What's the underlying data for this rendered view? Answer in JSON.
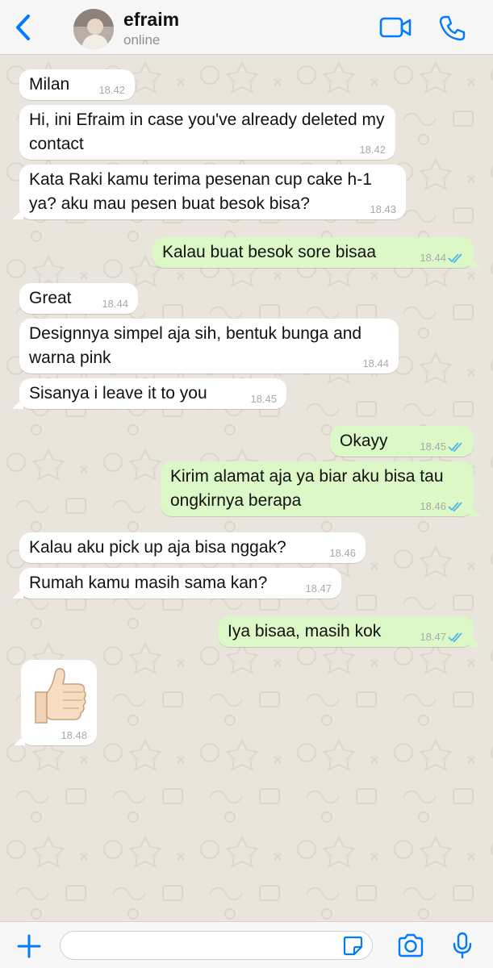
{
  "header": {
    "contact_name": "efraim",
    "status": "online",
    "icons": [
      "back-chevron-icon",
      "video-call-icon",
      "phone-call-icon"
    ]
  },
  "messages": [
    {
      "direction": "in",
      "text": "Milan",
      "time": "18.42"
    },
    {
      "direction": "in",
      "text": "Hi, ini Efraim in case you've already deleted my contact",
      "time": "18.42"
    },
    {
      "direction": "in",
      "text": "Kata Raki kamu terima pesenan cup cake h-1 ya? aku mau pesen buat besok bisa?",
      "time": "18.43"
    },
    {
      "direction": "out",
      "text": "Kalau buat besok sore bisaa",
      "time": "18.44",
      "status": "read"
    },
    {
      "direction": "in",
      "text": "Great",
      "time": "18.44"
    },
    {
      "direction": "in",
      "text": "Designnya simpel aja sih, bentuk bunga and warna pink",
      "time": "18.44"
    },
    {
      "direction": "in",
      "text": "Sisanya i leave it to you",
      "time": "18.45"
    },
    {
      "direction": "out",
      "text": "Okayy",
      "time": "18.45",
      "status": "read"
    },
    {
      "direction": "out",
      "text": "Kirim alamat aja ya biar aku bisa tau ongkirnya berapa",
      "time": "18.46",
      "status": "read"
    },
    {
      "direction": "in",
      "text": "Kalau aku pick up aja bisa nggak?",
      "time": "18.46"
    },
    {
      "direction": "in",
      "text": "Rumah kamu masih sama kan?",
      "time": "18.47"
    },
    {
      "direction": "out",
      "text": "Iya bisaa, masih kok",
      "time": "18.47",
      "status": "read"
    },
    {
      "direction": "in",
      "sticker": "thumbs-up",
      "time": "18.48"
    }
  ],
  "input": {
    "placeholder": "",
    "icons": [
      "plus-icon",
      "sticker-icon",
      "camera-icon",
      "microphone-icon"
    ]
  },
  "colors": {
    "accent": "#007aff",
    "outgoing_bubble": "#dcf8c6",
    "incoming_bubble": "#ffffff",
    "chat_background": "#e9e4dc",
    "read_check": "#4fb6ec"
  }
}
